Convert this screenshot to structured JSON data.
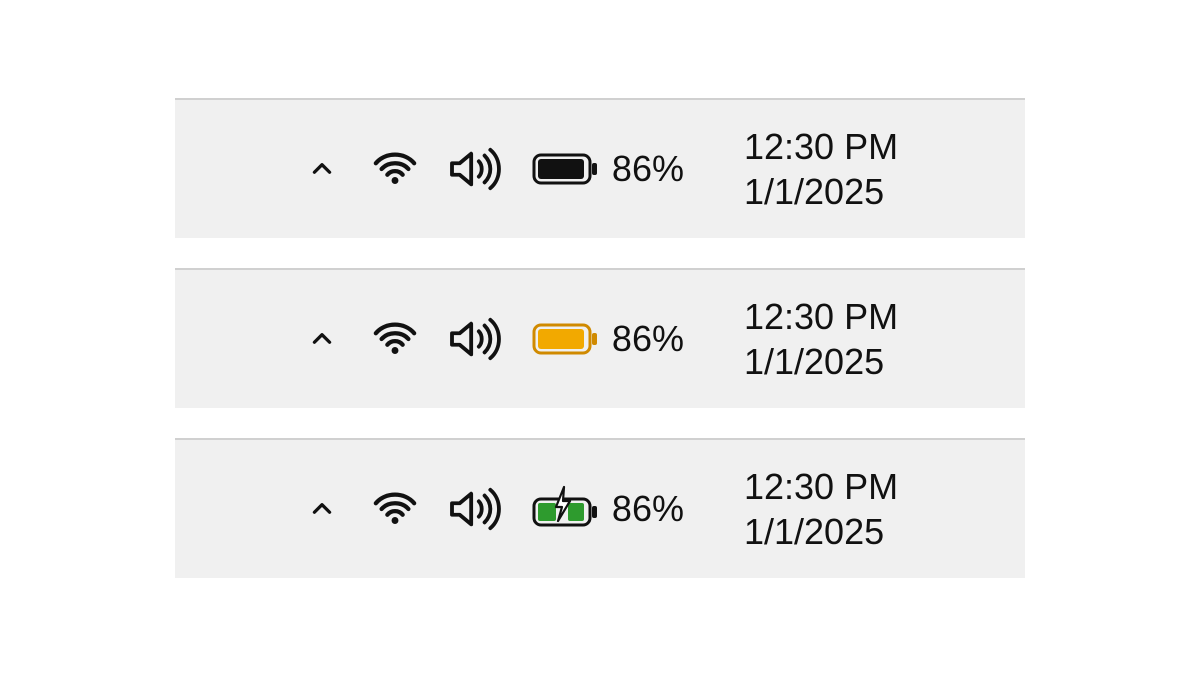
{
  "trays": [
    {
      "battery_percent": "86%",
      "time": "12:30 PM",
      "date": "1/1/2025",
      "battery_state": "normal",
      "battery_fill_color": "#111111",
      "battery_outline_color": "#111111",
      "charging": false
    },
    {
      "battery_percent": "86%",
      "time": "12:30 PM",
      "date": "1/1/2025",
      "battery_state": "saver",
      "battery_fill_color": "#f2a900",
      "battery_outline_color": "#d08a00",
      "charging": false
    },
    {
      "battery_percent": "86%",
      "time": "12:30 PM",
      "date": "1/1/2025",
      "battery_state": "charging",
      "battery_fill_color": "#2e9b2e",
      "battery_outline_color": "#111111",
      "charging": true
    }
  ],
  "icons": {
    "chevron_up": "chevron-up-icon",
    "wifi": "wifi-icon",
    "volume": "volume-icon",
    "battery": "battery-icon"
  }
}
